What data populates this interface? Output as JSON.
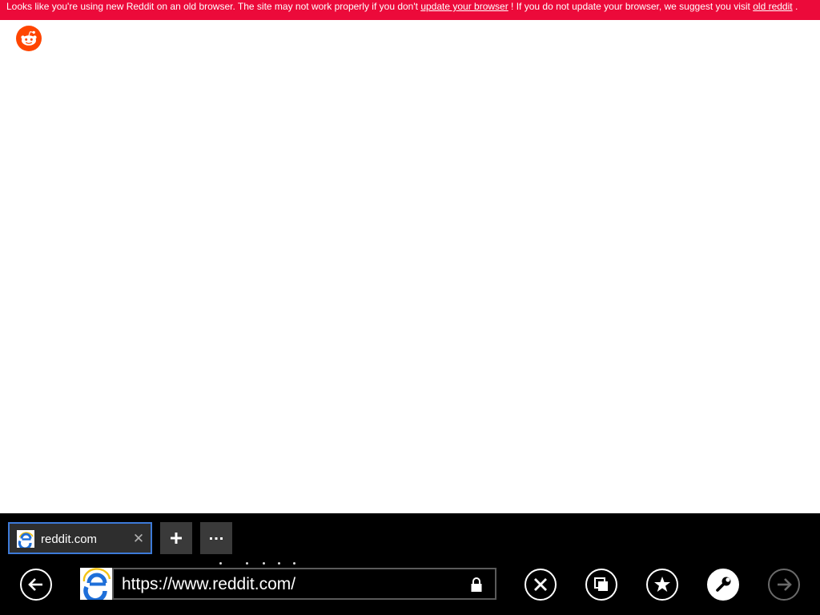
{
  "banner": {
    "text_before": "Looks like you're using new Reddit on an old browser. The site may not work properly if you don't ",
    "link_update": "update your browser",
    "text_middle": " ! If you do not update your browser, we suggest you visit ",
    "link_old": "old reddit",
    "text_after": " .",
    "background_color": "#ec0a3a"
  },
  "site": {
    "logo_icon": "reddit-alien-icon",
    "brand_color": "#ff4500"
  },
  "browser": {
    "tabs": [
      {
        "title": "reddit.com",
        "favicon": "ie-icon",
        "close_icon": "close-icon",
        "close_glyph": "✕",
        "active": true,
        "accent_color": "#3d7ad8"
      }
    ],
    "new_tab_icon": "plus-icon",
    "tab_menu_icon": "ellipsis-icon",
    "address_bar": {
      "favicon": "ie-icon",
      "url": "https://www.reddit.com/",
      "lock_icon": "lock-icon"
    },
    "buttons": {
      "back": "back-arrow-icon",
      "stop": "stop-x-icon",
      "tabs_view": "tabs-icon",
      "favorites": "star-icon",
      "page_tools": "wrench-icon",
      "forward": "forward-arrow-icon"
    }
  }
}
